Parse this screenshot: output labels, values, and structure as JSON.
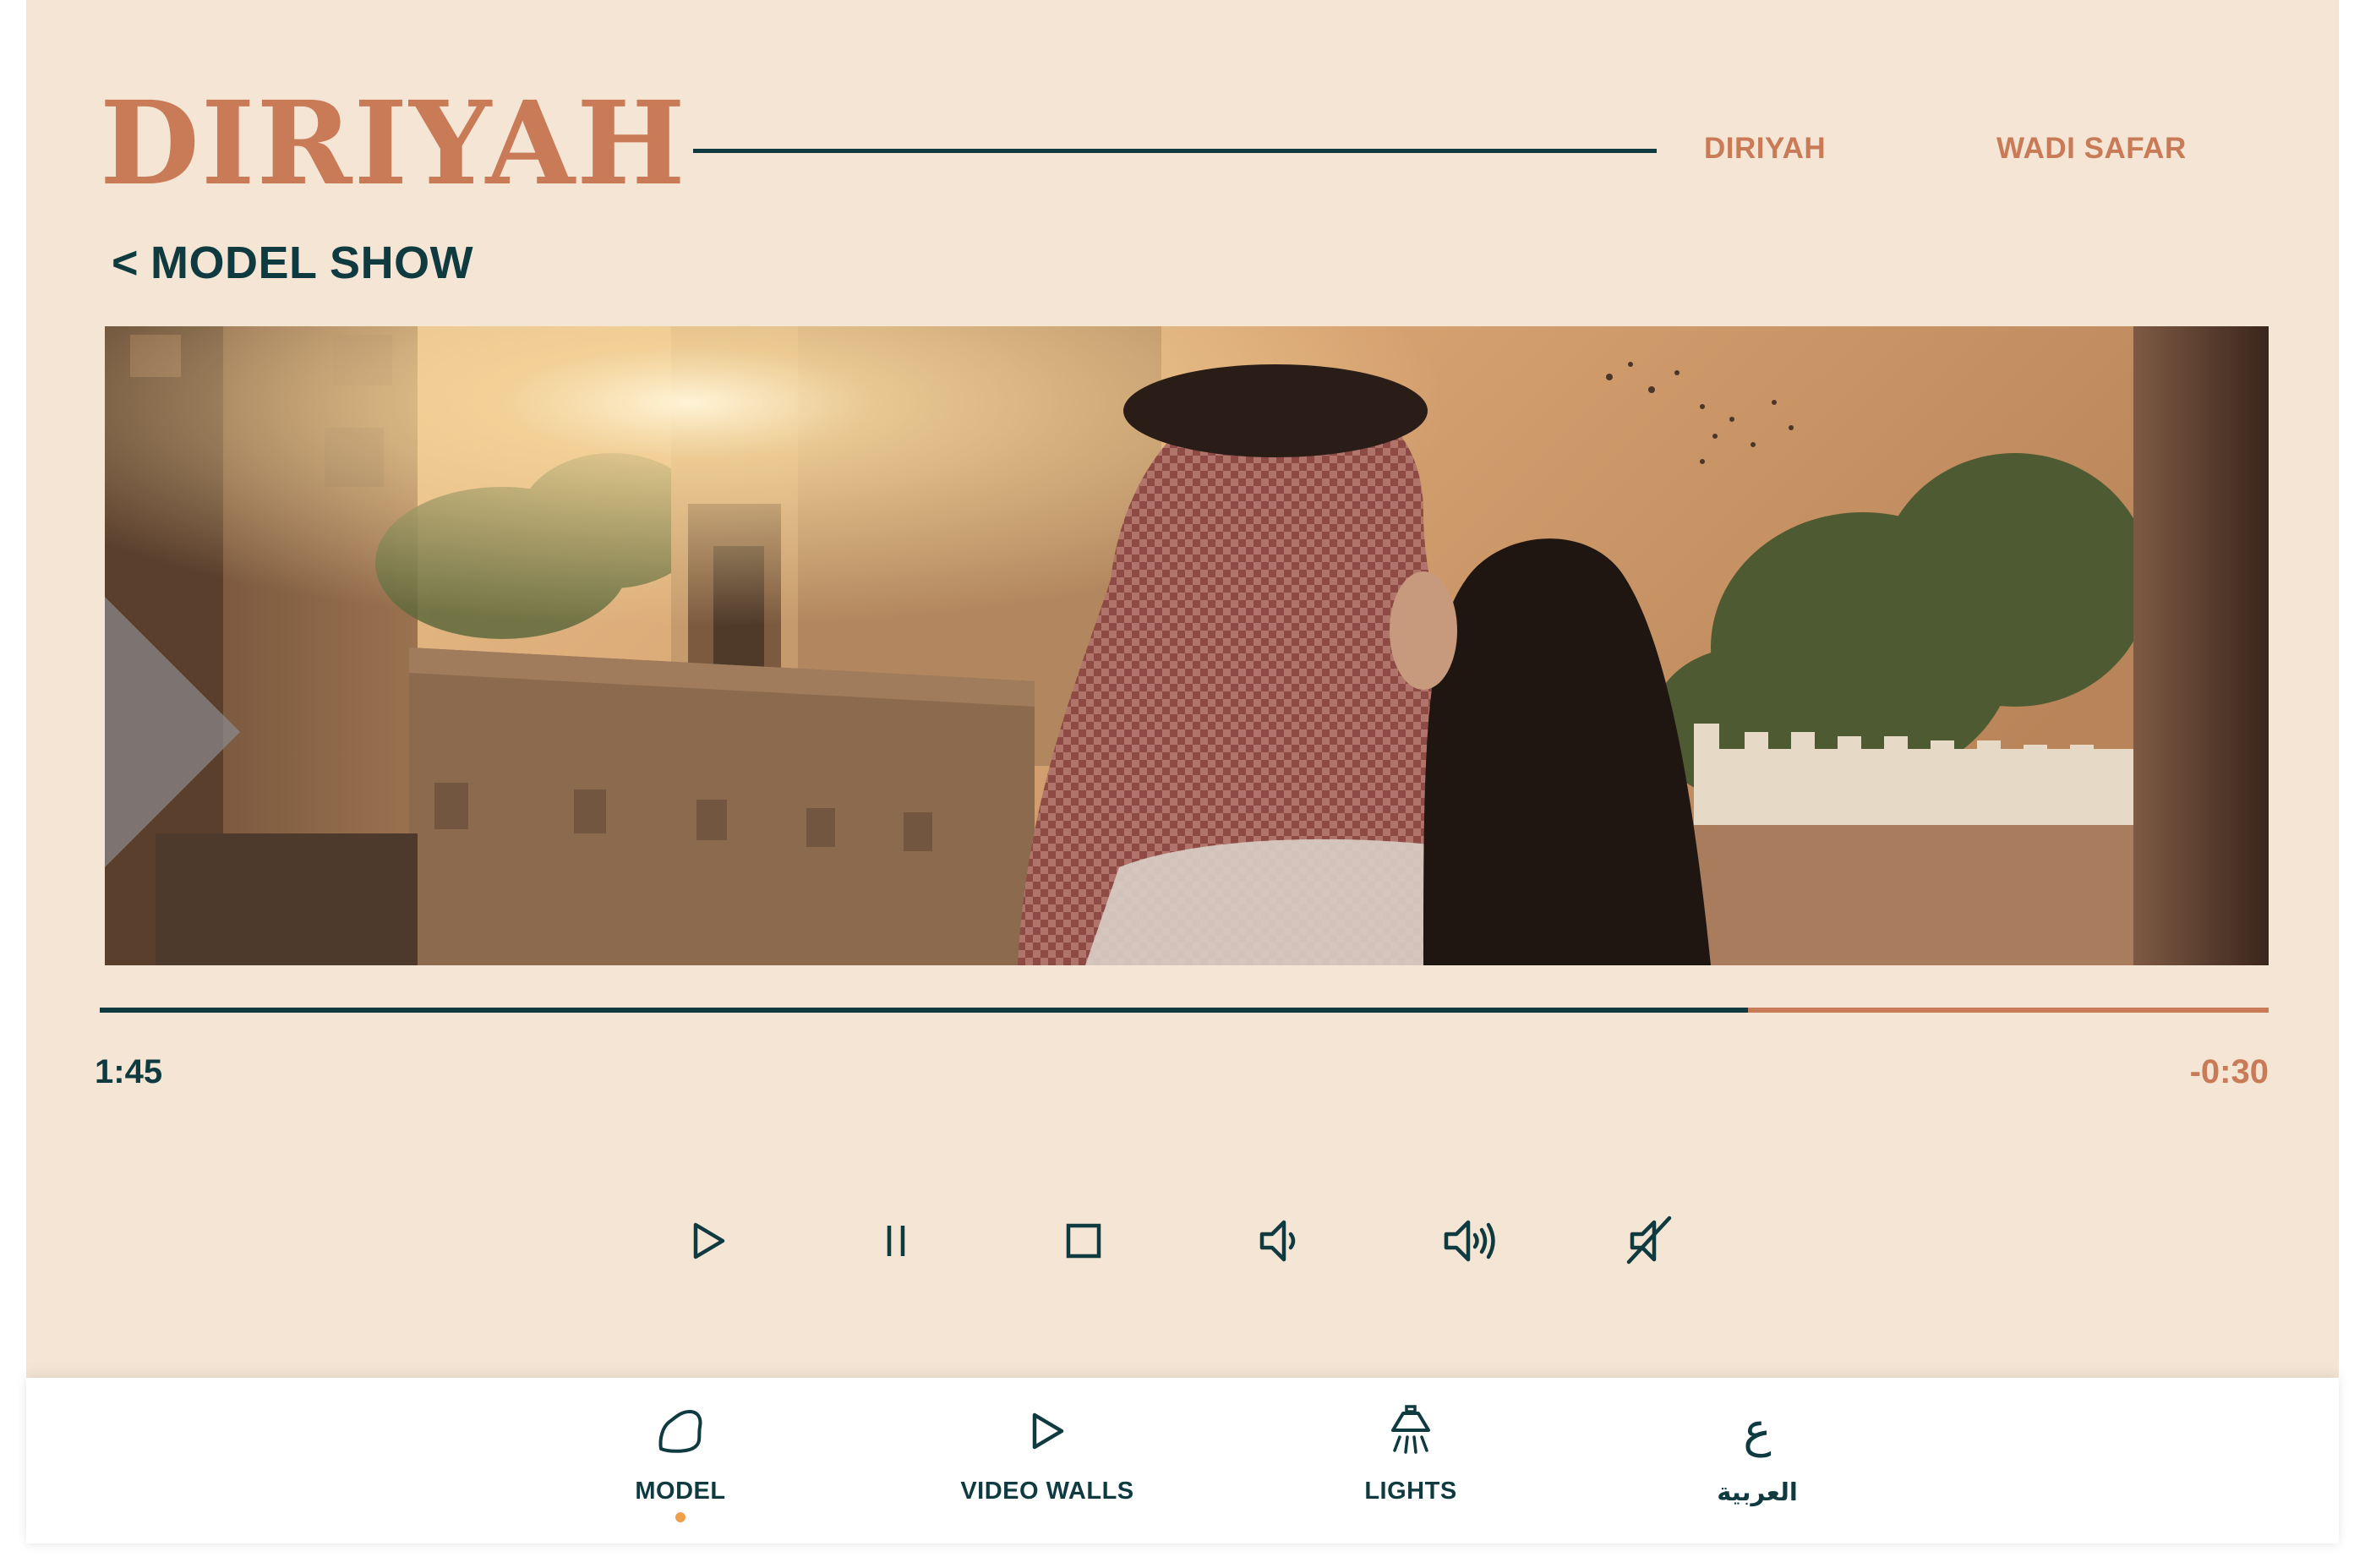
{
  "header": {
    "logo": "DIRIYAH",
    "nav": [
      {
        "label": "DIRIYAH"
      },
      {
        "label": "WADI SAFAR"
      }
    ]
  },
  "back": {
    "arrow": "<",
    "label": "MODEL SHOW"
  },
  "player": {
    "progress_fraction": 0.76,
    "elapsed": "1:45",
    "remaining": "-0:30",
    "controls": [
      {
        "name": "play",
        "icon": "play-icon"
      },
      {
        "name": "pause",
        "icon": "pause-icon"
      },
      {
        "name": "stop",
        "icon": "stop-icon"
      },
      {
        "name": "volume-down",
        "icon": "volume-low-icon"
      },
      {
        "name": "volume-up",
        "icon": "volume-high-icon"
      },
      {
        "name": "mute",
        "icon": "mute-icon"
      }
    ]
  },
  "tabbar": {
    "tabs": [
      {
        "label": "MODEL",
        "icon": "map-outline-icon",
        "active": true
      },
      {
        "label": "VIDEO WALLS",
        "icon": "play-icon",
        "active": false
      },
      {
        "label": "LIGHTS",
        "icon": "ceiling-lamp-icon",
        "active": false
      },
      {
        "label": "العربية",
        "icon": "arabic-letter-ain-icon",
        "active": false
      }
    ],
    "arabic_glyph": "ع"
  },
  "colors": {
    "background": "#f4e5d4",
    "accent": "#c97b58",
    "dark": "#0f3a40",
    "active_dot": "#f0a04b"
  }
}
